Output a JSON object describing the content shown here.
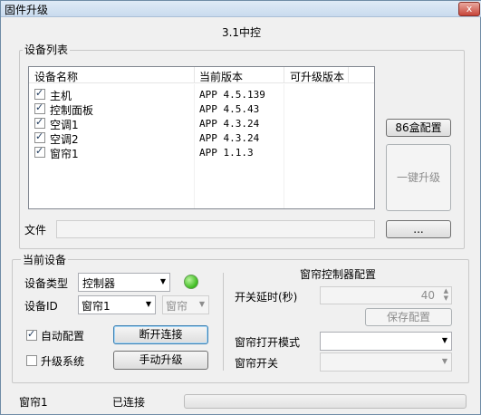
{
  "window": {
    "title": "固件升级",
    "close_glyph": "x",
    "heading": "3.1中控"
  },
  "device_list": {
    "group_label": "设备列表",
    "columns": [
      "设备名称",
      "当前版本",
      "可升级版本"
    ],
    "rows": [
      {
        "checked": true,
        "name": "主机",
        "version": "APP 4.5.139",
        "upgrade": ""
      },
      {
        "checked": true,
        "name": "控制面板",
        "version": "APP 4.5.43",
        "upgrade": ""
      },
      {
        "checked": true,
        "name": "空调1",
        "version": "APP 4.3.24",
        "upgrade": ""
      },
      {
        "checked": true,
        "name": "空调2",
        "version": "APP 4.3.24",
        "upgrade": ""
      },
      {
        "checked": true,
        "name": "窗帘1",
        "version": "APP 1.1.3",
        "upgrade": ""
      }
    ],
    "btn_86": "86盒配置",
    "btn_upgrade_all": "一键升级",
    "file_label": "文件",
    "file_value": "",
    "browse_label": "..."
  },
  "current_device": {
    "group_label": "当前设备",
    "type_label": "设备类型",
    "type_value": "控制器",
    "id_label": "设备ID",
    "id_value": "窗帘1",
    "id_kind": "窗帘",
    "auto_config_label": "自动配置",
    "auto_config_checked": true,
    "upgrade_system_label": "升级系统",
    "upgrade_system_checked": false,
    "disconnect_label": "断开连接",
    "manual_upgrade_label": "手动升级",
    "status_led_color": "#3dbb1f"
  },
  "curtain_config": {
    "title": "窗帘控制器配置",
    "delay_label": "开关延时(秒)",
    "delay_value": "40",
    "save_label": "保存配置",
    "open_mode_label": "窗帘打开模式",
    "open_mode_value": "",
    "switch_label": "窗帘开关",
    "switch_value": ""
  },
  "status_bar": {
    "device": "窗帘1",
    "connection": "已连接",
    "progress": 0
  }
}
